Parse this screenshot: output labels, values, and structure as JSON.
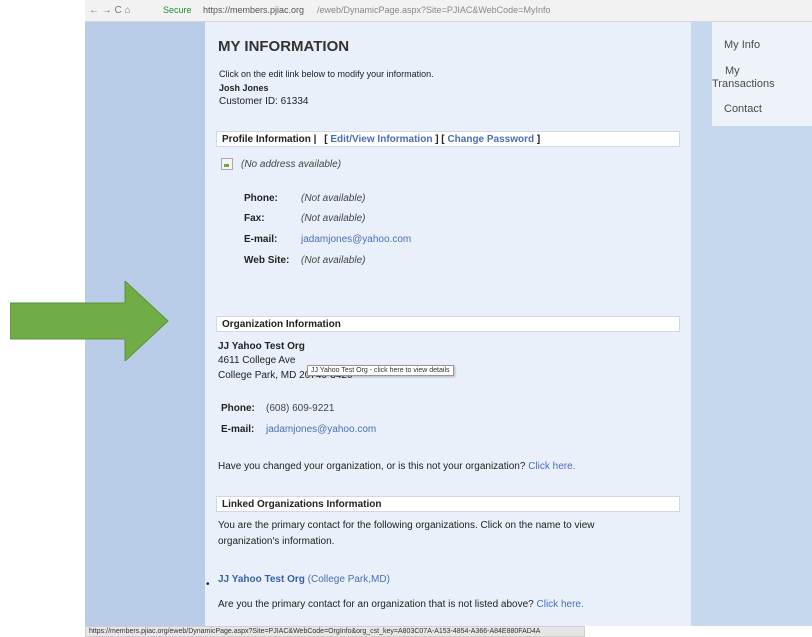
{
  "browser": {
    "nav": "← → C ⌂",
    "secure": "Secure",
    "url_host": "https://members.pjiac.org",
    "url_path": "/eweb/DynamicPage.aspx?Site=PJIAC&WebCode=MyInfo"
  },
  "status_url": "https://members.pjiac.org/eweb/DynamicPage.aspx?Site=PJIAC&WebCode=OrgInfo&org_cst_key=A803C07A-A153-4854-A366-A84E880FAD4A",
  "nav": {
    "my_info": "My Info",
    "my": "My",
    "transactions": "Transactions",
    "contact": "Contact"
  },
  "page": {
    "title": "MY INFORMATION",
    "intro": "Click on the edit link below to modify your information.",
    "name": "Josh Jones",
    "customer_id": "Customer ID: 61334"
  },
  "profile": {
    "heading": "Profile Information |",
    "bracket_open_1": "[",
    "edit_link": "Edit/View Information",
    "bracket_mid": "] [",
    "password_link": "Change Password",
    "bracket_close": "]",
    "no_address": "(No address available)",
    "phone_label": "Phone:",
    "phone_value": "(Not available)",
    "fax_label": "Fax:",
    "fax_value": "(Not available)",
    "email_label": "E-mail:",
    "email_value": "jadamjones@yahoo.com",
    "web_label": "Web Site:",
    "web_value": "(Not available)"
  },
  "organization": {
    "heading": "Organization Information",
    "name": "JJ Yahoo Test Org",
    "address1": "4611 College Ave",
    "address2": "College Park, MD 20740-3420",
    "tooltip": "JJ Yahoo Test Org - click here to view details",
    "phone_label": "Phone:",
    "phone_value": "(608) 609-9221",
    "email_label": "E-mail:",
    "email_value": "jadamjones@yahoo.com",
    "changed_text": "Have you changed your organization, or is this not your organization?",
    "click_here": "Click here."
  },
  "linked": {
    "heading": "Linked Organizations Information",
    "desc1": "You are the primary contact for the following organizations. Click on the name to view",
    "desc2": "organization's information.",
    "org_name": "JJ Yahoo Test Org",
    "org_location": "(College Park,MD)",
    "question": "Are you the primary contact for an organization that is not listed above?",
    "click_here": "Click here."
  },
  "colors": {
    "arrow": "#70ad47",
    "link": "#4a6eb5",
    "content_bg": "#e9f0f9"
  }
}
